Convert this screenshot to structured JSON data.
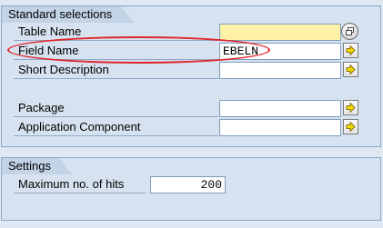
{
  "standard_selections": {
    "title": "Standard selections",
    "fields": [
      {
        "label": "Table Name",
        "value": "",
        "required": true,
        "button": "multiple-selection-icon"
      },
      {
        "label": "Field Name",
        "value": "EBELN",
        "required": false,
        "button": "arrow-right-icon"
      },
      {
        "label": "Short Description",
        "value": "",
        "required": false,
        "button": "arrow-right-icon"
      },
      {
        "label": "Package",
        "value": "",
        "required": false,
        "button": "arrow-right-icon"
      },
      {
        "label": "Application Component",
        "value": "",
        "required": false,
        "button": "arrow-right-icon"
      }
    ]
  },
  "settings": {
    "title": "Settings",
    "max_hits_label": "Maximum no. of hits",
    "max_hits_value": "200"
  },
  "colors": {
    "annotation": "#e0262b",
    "required_field": "#fff2a8",
    "arrow_yellow": "#f5d800"
  }
}
